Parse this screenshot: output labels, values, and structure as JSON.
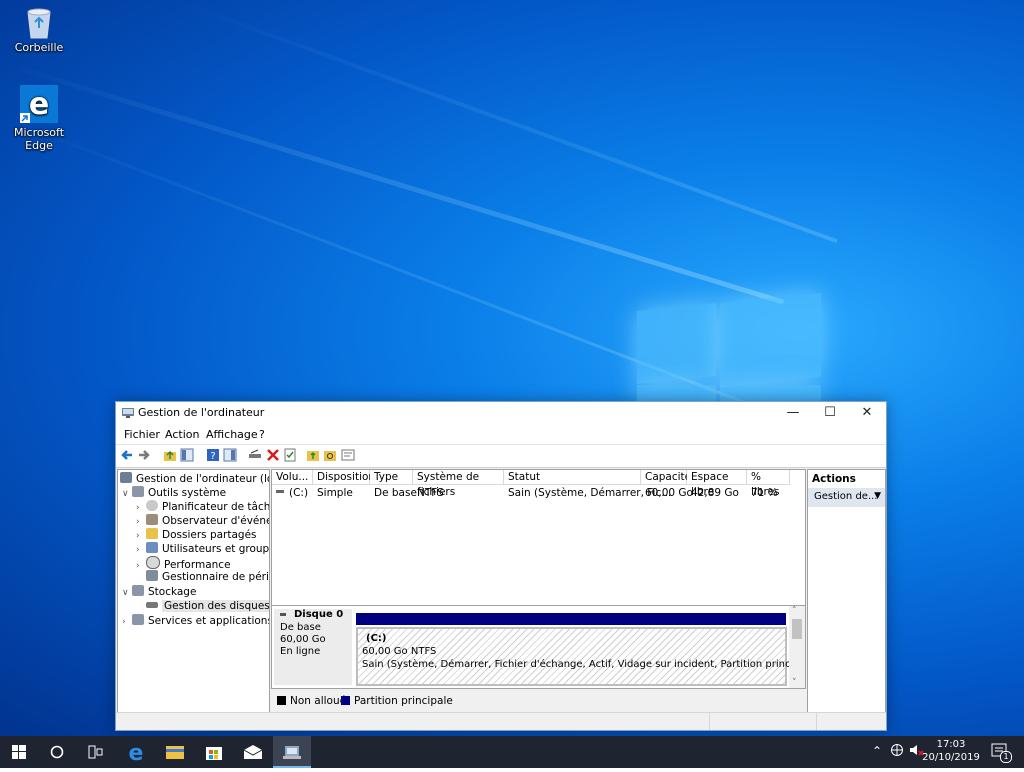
{
  "desktop": {
    "icons": [
      {
        "label": "Corbeille",
        "icon": "recycle-bin-icon"
      },
      {
        "label": "Microsoft Edge",
        "icon": "edge-icon"
      }
    ]
  },
  "window": {
    "title": "Gestion de l'ordinateur",
    "menu": [
      "Fichier",
      "Action",
      "Affichage",
      "?"
    ],
    "tree": [
      {
        "label": "Gestion de l'ordinateur (local)",
        "icon": "computer-management-icon"
      },
      {
        "label": "Outils système",
        "icon": "tools-icon"
      },
      {
        "label": "Planificateur de tâches",
        "icon": "task-scheduler-icon"
      },
      {
        "label": "Observateur d'événeme",
        "icon": "event-viewer-icon"
      },
      {
        "label": "Dossiers partagés",
        "icon": "shared-folders-icon"
      },
      {
        "label": "Utilisateurs et groupes l",
        "icon": "users-groups-icon"
      },
      {
        "label": "Performance",
        "icon": "performance-icon"
      },
      {
        "label": "Gestionnaire de périphé",
        "icon": "device-manager-icon"
      },
      {
        "label": "Stockage",
        "icon": "storage-icon"
      },
      {
        "label": "Gestion des disques",
        "icon": "disk-management-icon"
      },
      {
        "label": "Services et applications",
        "icon": "services-icon"
      }
    ],
    "columns": [
      "Volu...",
      "Disposition",
      "Type",
      "Système de fichiers",
      "Statut",
      "Capacité",
      "Espace libre",
      "% libres"
    ],
    "volume_row": {
      "volume": "(C:)",
      "disposition": "Simple",
      "type": "De base",
      "fs": "NTFS",
      "status": "Sain (Système, Démarrer, Fic...",
      "capacity": "60,00 Go",
      "free": "42,89 Go",
      "pct_free": "71 %"
    },
    "disk": {
      "name": "Disque 0",
      "kind": "De base",
      "size": "60,00 Go",
      "state": "En ligne",
      "partition_label": "(C:)",
      "partition_size": "60,00 Go NTFS",
      "partition_status": "Sain (Système, Démarrer, Fichier d'échange, Actif, Vidage sur incident, Partition principale)"
    },
    "legend": {
      "unallocated": "Non alloué",
      "primary": "Partition principale",
      "unallocated_color": "#000000",
      "primary_color": "#000080"
    },
    "actions": {
      "header": "Actions",
      "item": "Gestion de..."
    }
  },
  "taskbar": {
    "clock_time": "17:03",
    "clock_date": "20/10/2019",
    "notification_count": "1"
  }
}
